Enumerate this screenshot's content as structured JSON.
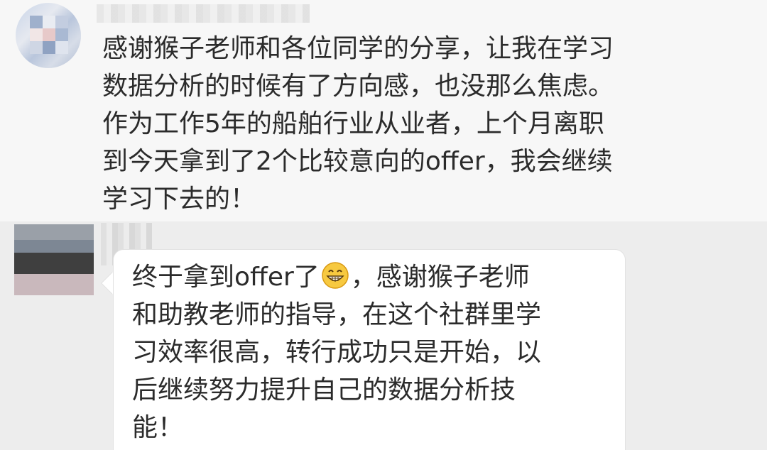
{
  "messages": [
    {
      "text_lines": [
        "感谢猴子老师和各位同学的分享，让我在学习",
        "数据分析的时候有了方向感，也没那么焦虑。",
        "作为工作5年的船舶行业从业者，上个月离职",
        "到今天拿到了2个比较意向的offer，我会继续",
        "学习下去的！"
      ]
    },
    {
      "line1_before_emoji": "终于拿到offer了",
      "emoji": "grinning-face-emoji",
      "line1_after_emoji": "，感谢猴子老师",
      "text_lines": [
        "和助教老师的指导，在这个社群里学",
        "习效率很高，转行成功只是开始，以",
        "后继续努力提升自己的数据分析技",
        "能！"
      ]
    }
  ],
  "colors": {
    "top_panel_bg": "#f7f7f7",
    "bottom_panel_bg": "#ededed",
    "bubble_bg": "#ffffff",
    "text": "#2b2b2b"
  }
}
